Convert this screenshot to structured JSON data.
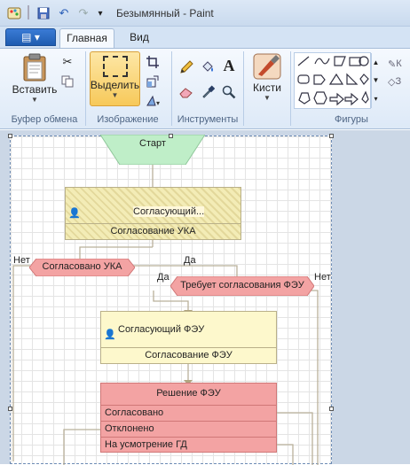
{
  "window": {
    "title": "Безымянный - Paint"
  },
  "quick_access": {
    "customize_glyph": "▾"
  },
  "tabs": {
    "file_label": "▤ ▾",
    "home": "Главная",
    "view": "Вид"
  },
  "ribbon": {
    "clipboard": {
      "paste": "Вставить",
      "group": "Буфер обмена"
    },
    "image": {
      "select": "Выделить",
      "group": "Изображение"
    },
    "tools": {
      "group": "Инструменты",
      "text_glyph": "A"
    },
    "brushes": {
      "label": "Кисти"
    },
    "shapes": {
      "group": "Фигуры",
      "outline_cut": "К",
      "fill_cut": "З"
    }
  },
  "flow": {
    "start": "Старт",
    "ukha": {
      "person": "Согласующий...",
      "title": "Согласование УКА"
    },
    "decision1": {
      "label": "Согласовано УКА",
      "no": "Нет",
      "yes": "Да"
    },
    "decision2": {
      "label": "Требует согласования ФЭУ",
      "yes": "Да",
      "no": "Нет"
    },
    "feu": {
      "person": "Согласующий ФЭУ",
      "title": "Согласование ФЭУ"
    },
    "decision_feu": {
      "title": "Решение ФЭУ",
      "options": [
        "Согласовано",
        "Отклонено",
        "На усмотрение ГД"
      ]
    }
  },
  "colors": {
    "accent": "#1f5cb0",
    "start": "#bfeec8",
    "decision": "#f3a3a3",
    "task": "#fdf8cc"
  }
}
